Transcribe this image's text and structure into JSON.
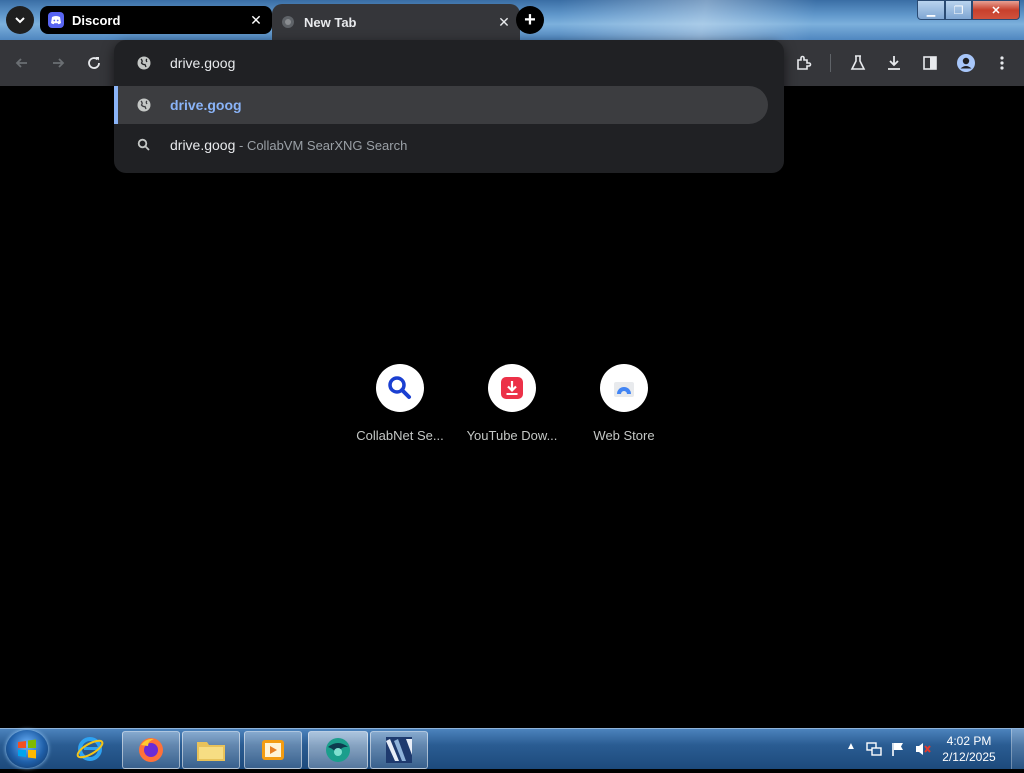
{
  "tabs": [
    {
      "title": "Discord",
      "icon": "discord-icon"
    },
    {
      "title": "New Tab",
      "icon": "globe-icon"
    }
  ],
  "omnibox": {
    "input_text": "drive.goog",
    "suggestions": [
      {
        "main": "drive.goog",
        "desc": "",
        "icon": "globe-icon"
      },
      {
        "main": "drive.goog",
        "desc": " - CollabVM SearXNG Search",
        "icon": "search-icon"
      }
    ]
  },
  "shortcuts": [
    {
      "label": "CollabNet Se...",
      "icon": "magnifier-icon"
    },
    {
      "label": "YouTube Dow...",
      "icon": "download-icon"
    },
    {
      "label": "Web Store",
      "icon": "webstore-icon"
    }
  ],
  "taskbar": {
    "apps": [
      "internet-explorer",
      "firefox",
      "file-explorer",
      "media-player",
      "browser-app",
      "video-editor"
    ],
    "time": "4:02 PM",
    "date": "2/12/2025"
  },
  "colors": {
    "accent": "#8ab4f8",
    "toolbar": "#35363a",
    "popup": "#202124"
  }
}
